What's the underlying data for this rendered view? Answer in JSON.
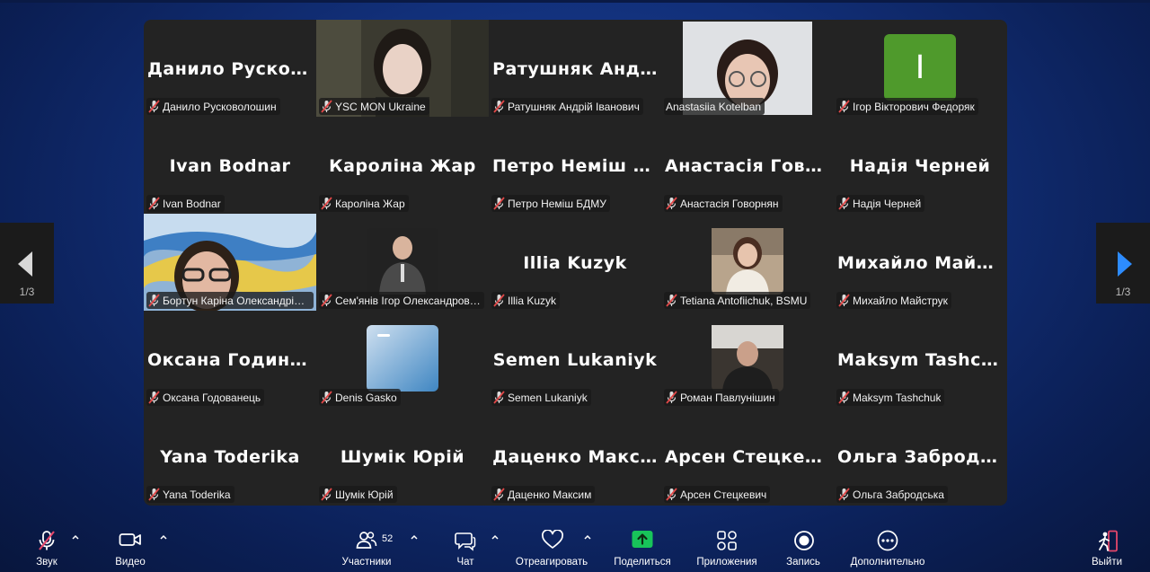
{
  "tiles": [
    {
      "big": "Данило  Русков…",
      "label": "Данило Русковолошин"
    },
    {
      "big": "",
      "label": "YSC MON Ukraine"
    },
    {
      "big": "Ратушняк  Анд…",
      "label": "Ратушняк Андрій Іванович"
    },
    {
      "big": "",
      "label": "Anastasiia Kotelban"
    },
    {
      "big": "",
      "label": "Ігор Вікторович Федоряк",
      "avatar_letter": "І"
    },
    {
      "big": "Ivan Bodnar",
      "label": "Ivan Bodnar"
    },
    {
      "big": "Кароліна Жар",
      "label": "Кароліна Жар"
    },
    {
      "big": "Петро  Неміш  Б…",
      "label": "Петро Неміш БДМУ"
    },
    {
      "big": "Анастасія  Гово…",
      "label": "Анастасія Говорнян"
    },
    {
      "big": "Надія Черней",
      "label": "Надія Черней"
    },
    {
      "big": "",
      "label": "Бортун Каріна Олександрів…"
    },
    {
      "big": "",
      "label": "Сем'янів Ігор Олександров…"
    },
    {
      "big": "Illia Kuzyk",
      "label": "Illia Kuzyk"
    },
    {
      "big": "",
      "label": "Tetiana Antofiichuk, BSMU"
    },
    {
      "big": "Михайло  Майс…",
      "label": "Михайло Майструк"
    },
    {
      "big": "Оксана  Година…",
      "label": "Оксана Годованець"
    },
    {
      "big": "",
      "label": "Denis Gasko"
    },
    {
      "big": "Semen Lukaniyk",
      "label": "Semen Lukaniyk"
    },
    {
      "big": "",
      "label": "Роман Павлунішин"
    },
    {
      "big": "Maksym  Tashch…",
      "label": "Maksym Tashchuk"
    },
    {
      "big": "Yana Toderika",
      "label": "Yana Toderika"
    },
    {
      "big": "Шумік Юрій",
      "label": "Шумік Юрій"
    },
    {
      "big": "Даценко  Макс…",
      "label": "Даценко Максим"
    },
    {
      "big": "Арсен Стецкевич",
      "label": "Арсен Стецкевич"
    },
    {
      "big": "Ольга  Забродс…",
      "label": "Ольга Забродська"
    }
  ],
  "pager": {
    "left": "1/3",
    "right": "1/3"
  },
  "toolbar": {
    "audio": "Звук",
    "video": "Видео",
    "participants": "Участники",
    "participants_count": "52",
    "chat": "Чат",
    "react": "Отреагировать",
    "share": "Поделиться",
    "apps": "Приложения",
    "record": "Запись",
    "more": "Дополнительно",
    "leave": "Выйти"
  },
  "colors": {
    "active_speaker": "#2ee6a6",
    "share": "#18c45a",
    "leave": "#e5476b",
    "avatar": "#4f9a2c"
  }
}
